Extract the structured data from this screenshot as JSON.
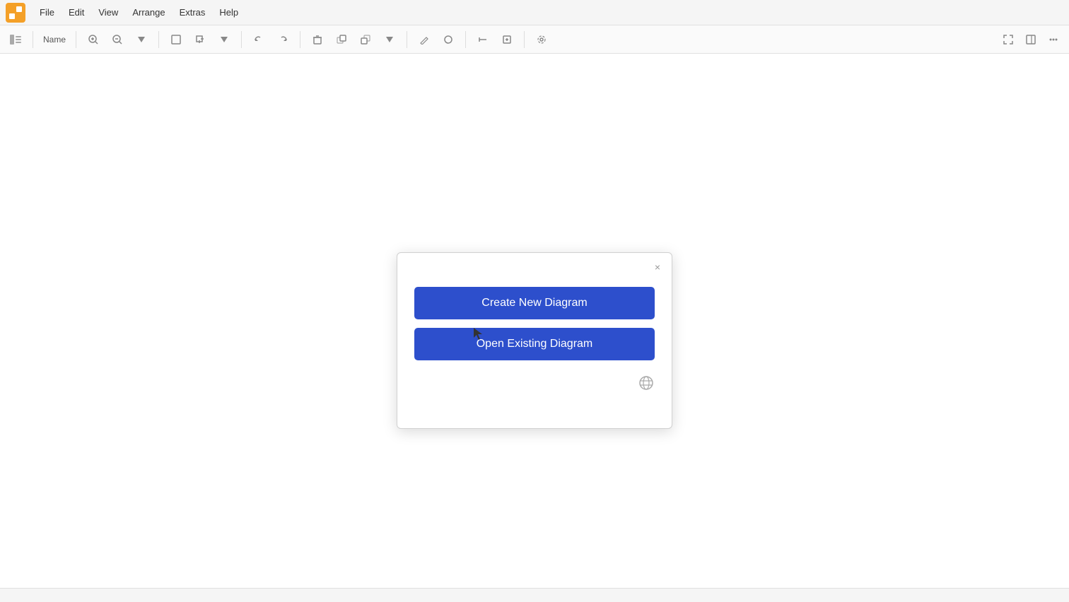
{
  "app": {
    "logo_alt": "draw.io logo"
  },
  "menubar": {
    "items": [
      {
        "label": "File",
        "id": "file"
      },
      {
        "label": "Edit",
        "id": "edit"
      },
      {
        "label": "View",
        "id": "view"
      },
      {
        "label": "Arrange",
        "id": "arrange"
      },
      {
        "label": "Extras",
        "id": "extras"
      },
      {
        "label": "Help",
        "id": "help"
      }
    ]
  },
  "toolbar": {
    "zoom_label": "Name",
    "zoom_in_label": "+",
    "zoom_out_label": "-"
  },
  "dialog": {
    "create_btn_label": "Create New Diagram",
    "open_btn_label": "Open Existing Diagram",
    "close_label": "×",
    "globe_title": "Language settings"
  },
  "statusbar": {
    "text": ""
  }
}
